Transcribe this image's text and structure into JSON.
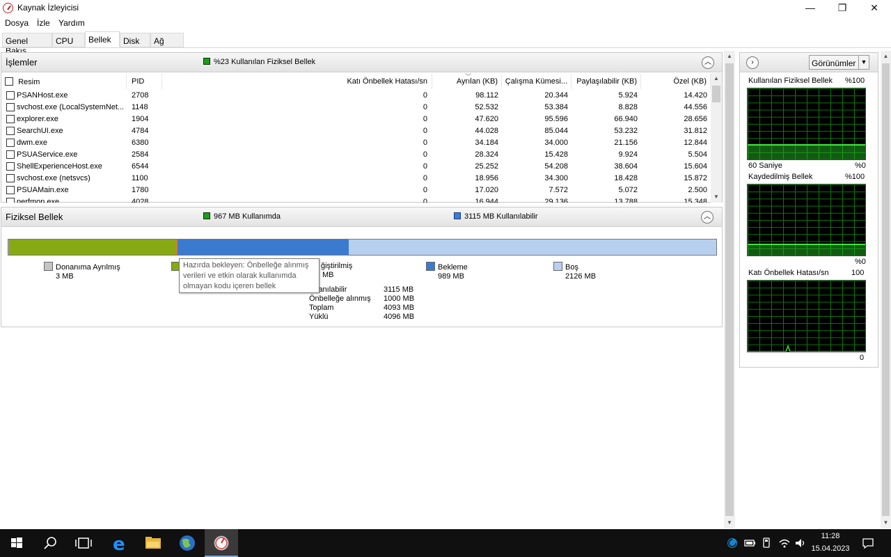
{
  "window": {
    "title": "Kaynak İzleyicisi"
  },
  "window_controls": {
    "minimize": "—",
    "maximize": "❐",
    "close": "✕"
  },
  "menu": [
    "Dosya",
    "İzle",
    "Yardım"
  ],
  "tabs": [
    "Genel Bakış",
    "CPU",
    "Bellek",
    "Disk",
    "Ağ"
  ],
  "active_tab": "Bellek",
  "processes_panel": {
    "title": "İşlemler",
    "summary": "%23 Kullanılan Fiziksel Bellek",
    "columns": [
      "Resim",
      "PID",
      "Katı Önbellek Hatası/sn",
      "Ayrılan (KB)",
      "Çalışma Kümesi...",
      "Paylaşılabilir (KB)",
      "Özel (KB)"
    ],
    "rows": [
      [
        "PSANHost.exe",
        "2708",
        "0",
        "98.112",
        "20.344",
        "5.924",
        "14.420"
      ],
      [
        "svchost.exe (LocalSystemNet...",
        "1148",
        "0",
        "52.532",
        "53.384",
        "8.828",
        "44.556"
      ],
      [
        "explorer.exe",
        "1904",
        "0",
        "47.620",
        "95.596",
        "66.940",
        "28.656"
      ],
      [
        "SearchUI.exe",
        "4784",
        "0",
        "44.028",
        "85.044",
        "53.232",
        "31.812"
      ],
      [
        "dwm.exe",
        "6380",
        "0",
        "34.184",
        "34.000",
        "21.156",
        "12.844"
      ],
      [
        "PSUAService.exe",
        "2584",
        "0",
        "28.324",
        "15.428",
        "9.924",
        "5.504"
      ],
      [
        "ShellExperienceHost.exe",
        "6544",
        "0",
        "25.252",
        "54.208",
        "38.604",
        "15.604"
      ],
      [
        "svchost.exe (netsvcs)",
        "1100",
        "0",
        "18.956",
        "34.300",
        "18.428",
        "15.872"
      ],
      [
        "PSUAMain.exe",
        "1780",
        "0",
        "17.020",
        "7.572",
        "5.072",
        "2.500"
      ],
      [
        "perfmon.exe",
        "4028",
        "0",
        "16.944",
        "29.136",
        "13.788",
        "15.348"
      ]
    ]
  },
  "physical_memory_panel": {
    "title": "Fiziksel Bellek",
    "in_use": "967 MB Kullanımda",
    "available": "3115 MB Kullanılabilir",
    "bar_mb": {
      "reserved": 3,
      "in_use": 967,
      "modified": 8,
      "standby": 989,
      "free": 2126,
      "total": 4093
    },
    "legend": [
      {
        "label": "Donanıma Ayrılmış",
        "value": "3 MB",
        "color": "#a9a9a9"
      },
      {
        "label": "Kullanımda",
        "value": "967 MB",
        "color": "#86a914"
      },
      {
        "label": "Değiştirilmiş",
        "value": "8 MB",
        "color": "#e07a1f"
      },
      {
        "label": "Bekleme",
        "value": "989 MB",
        "color": "#3b7bcf"
      },
      {
        "label": "Boş",
        "value": "2126 MB",
        "color": "#b8d0ef"
      }
    ],
    "legend_visible": {
      "modified_label": "ğiştirilmiş",
      "modified_value": "MB"
    },
    "stats": [
      {
        "label": "Kullanılabilir",
        "visible_label": "lanılabilir",
        "value": "3115 MB"
      },
      {
        "label": "Önbelleğe alınmış",
        "value": "1000 MB"
      },
      {
        "label": "Toplam",
        "value": "4093 MB"
      },
      {
        "label": "Yüklü",
        "value": "4096 MB"
      }
    ],
    "tooltip": "Hazırda bekleyen: Önbelleğe alınmış verileri ve etkin olarak kullanımda olmayan kodu içeren bellek"
  },
  "side_panel": {
    "views_button": "Görünümler",
    "graphs": [
      {
        "title": "Kullanılan Fiziksel Bellek",
        "max": "%100",
        "bottom_left": "60 Saniye",
        "bottom_right": "%0",
        "level": 0.23
      },
      {
        "title": "Kaydedilmiş Bellek",
        "max": "%100",
        "bottom_left": "",
        "bottom_right": "%0",
        "level": 0.18
      },
      {
        "title": "Katı Önbellek Hatası/sn",
        "max": "100",
        "bottom_left": "",
        "bottom_right": "0",
        "level": 0.0
      }
    ]
  },
  "taskbar": {
    "time": "11:28",
    "date": "15.04.2023"
  },
  "colors": {
    "graph_line": "#3ce03c",
    "graph_grid": "#0b7a0b",
    "in_use_green": "#86a914",
    "standby_blue": "#3b7bcf",
    "free_blue": "#b8d0ef"
  }
}
